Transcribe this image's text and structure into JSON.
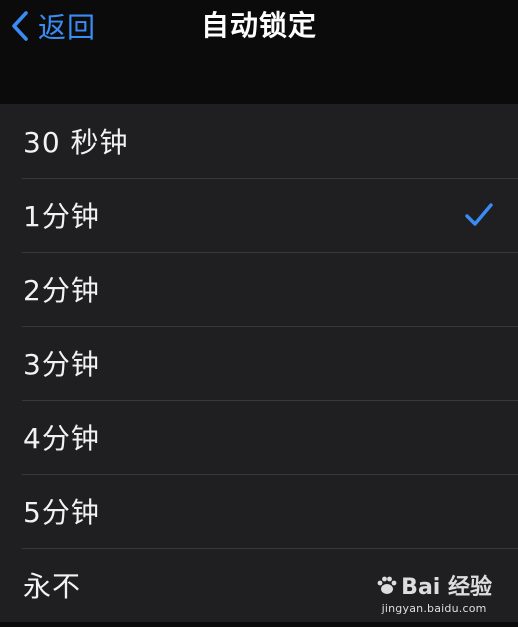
{
  "navbar": {
    "back_label": "返回",
    "title": "自动锁定"
  },
  "options": [
    {
      "label": "30 秒钟",
      "selected": false
    },
    {
      "label": "1分钟",
      "selected": true
    },
    {
      "label": "2分钟",
      "selected": false
    },
    {
      "label": "3分钟",
      "selected": false
    },
    {
      "label": "4分钟",
      "selected": false
    },
    {
      "label": "5分钟",
      "selected": false
    },
    {
      "label": "永不",
      "selected": false
    }
  ],
  "watermark": {
    "logo_text": "Bai 经验",
    "url": "jingyan.baidu.com"
  },
  "colors": {
    "accent": "#3a8cf5",
    "background": "#0b0b0c",
    "row_background": "#1f1f22",
    "separator": "#38383b"
  },
  "icons": {
    "back": "chevron-left-icon",
    "selected": "checkmark-icon",
    "watermark": "paw-icon"
  }
}
